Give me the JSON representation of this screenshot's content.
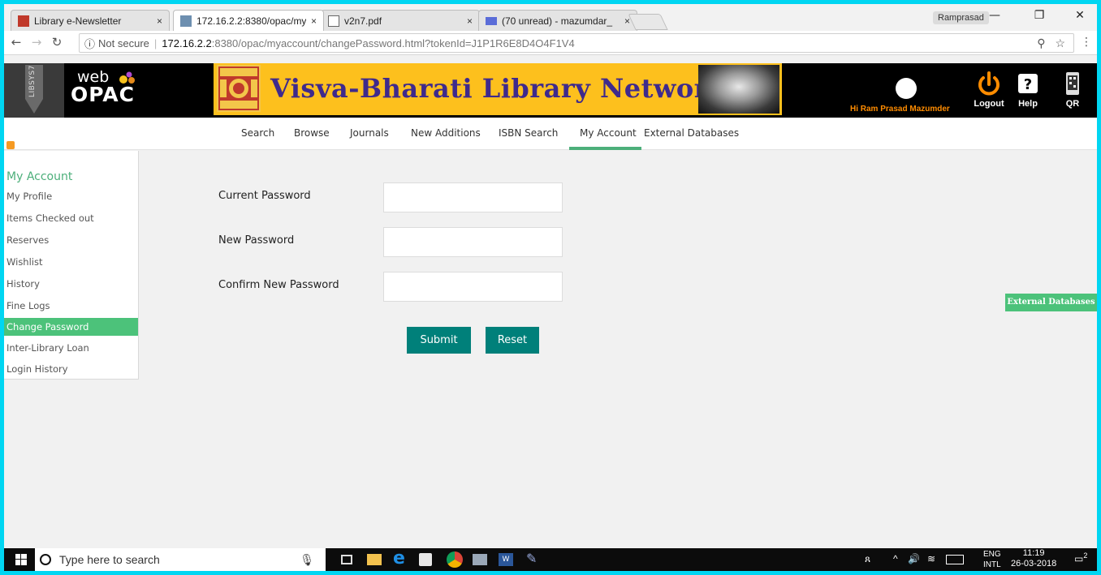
{
  "browser": {
    "tabs": [
      {
        "title": "Library e-Newsletter",
        "close": "×"
      },
      {
        "title": "172.16.2.2:8380/opac/my",
        "close": "×"
      },
      {
        "title": "v2n7.pdf",
        "close": "×"
      },
      {
        "title": "(70 unread) - mazumdar_",
        "close": "×"
      }
    ],
    "profile_name": "Ramprasad",
    "window_controls": {
      "minimize": "—",
      "maximize": "❐",
      "close": "✕"
    },
    "security_label": "Not secure",
    "url_host": "172.16.2.2",
    "url_rest": ":8380/opac/myaccount/changePassword.html?tokenId=J1P1R6E8D4O4F1V4"
  },
  "header": {
    "libsys_tag": "LIBSYS7",
    "logo_web": "web",
    "logo_opac": "OPAC",
    "site_title": "Visva-Bharati Library Network",
    "greeting": "Hi Ram Prasad Mazumder",
    "logout_label": "Logout",
    "help_label": "Help",
    "qr_label": "QR"
  },
  "nav": {
    "items": [
      "Search",
      "Browse",
      "Journals",
      "New Additions",
      "ISBN Search",
      "My Account",
      "External Databases"
    ],
    "active": "My Account"
  },
  "sidebar": {
    "heading": "My Account",
    "items": [
      "My Profile",
      "Items Checked out",
      "Reserves",
      "Wishlist",
      "History",
      "Fine Logs",
      "Change Password",
      "Inter-Library Loan",
      "Login History"
    ],
    "active": "Change Password"
  },
  "form": {
    "current_password_label": "Current Password",
    "new_password_label": "New Password",
    "confirm_password_label": "Confirm New Password",
    "current_password_value": "",
    "new_password_value": "",
    "confirm_password_value": "",
    "submit_label": "Submit",
    "reset_label": "Reset"
  },
  "side_tab": {
    "label": "External Databases"
  },
  "taskbar": {
    "search_placeholder": "Type here to search",
    "language_top": "ENG",
    "language_bottom": "INTL",
    "time": "11:19",
    "date": "26-03-2018",
    "notification_count": "2"
  },
  "colors": {
    "accent_green": "#4cc27a",
    "button_teal": "#00807a",
    "banner_yellow": "#fdc01d",
    "title_purple": "#3f2a8c",
    "greeting_orange": "#ff8c00"
  }
}
